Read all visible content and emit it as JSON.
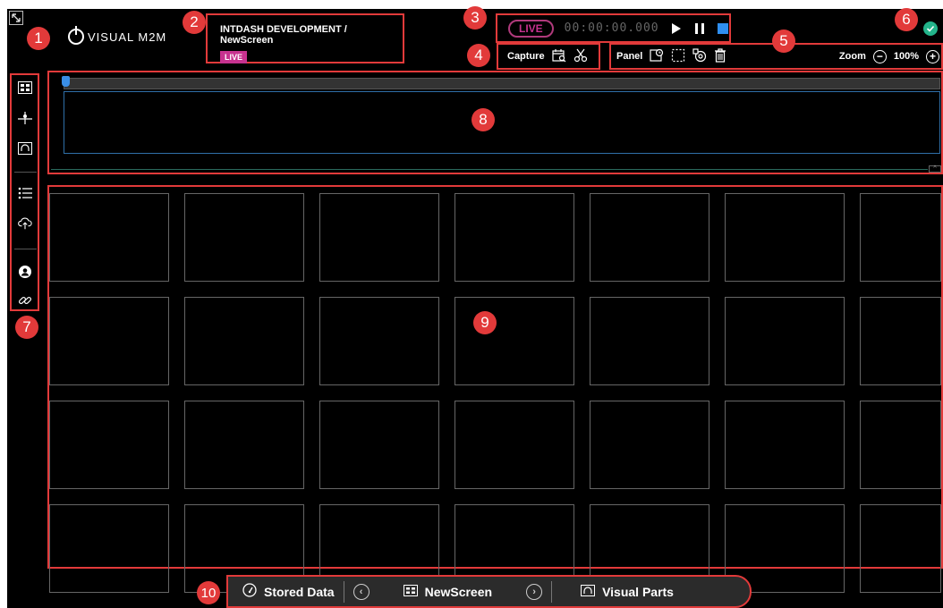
{
  "app": {
    "logo_text": "VISUAL M2M",
    "project_title": "INTDASH DEVELOPMENT / NewScreen",
    "live_badge": "LIVE"
  },
  "player": {
    "live_label": "LIVE",
    "timecode": "00:00:00.000"
  },
  "capture": {
    "label": "Capture"
  },
  "panel_toolbar": {
    "label": "Panel"
  },
  "zoom": {
    "label": "Zoom",
    "value": "100%"
  },
  "bottom_bar": {
    "stored_data": "Stored Data",
    "screen_name": "NewScreen",
    "visual_parts": "Visual Parts"
  },
  "callouts": [
    "1",
    "2",
    "3",
    "4",
    "5",
    "6",
    "7",
    "8",
    "9",
    "10"
  ],
  "colors": {
    "callout": "#e23a3a",
    "live": "#c7328f",
    "status_ok": "#23b48b",
    "timeline_marker": "#3a8ee6",
    "stop_button": "#2f8ff0"
  }
}
